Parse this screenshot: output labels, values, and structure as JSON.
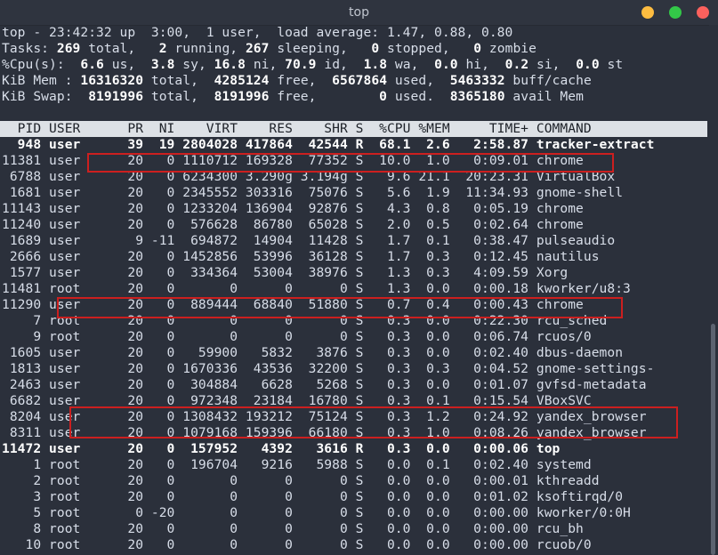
{
  "window": {
    "title": "top"
  },
  "summary": {
    "uptime_line": "top - 23:42:32 up  3:00,  1 user,  load average: 1.47, 0.88, 0.80",
    "tasks": [
      {
        "t": "Tasks: "
      },
      {
        "t": "269",
        "b": true
      },
      {
        "t": " total,   "
      },
      {
        "t": "2",
        "b": true
      },
      {
        "t": " running, "
      },
      {
        "t": "267",
        "b": true
      },
      {
        "t": " sleeping,   "
      },
      {
        "t": "0",
        "b": true
      },
      {
        "t": " stopped,   "
      },
      {
        "t": "0",
        "b": true
      },
      {
        "t": " zombie"
      }
    ],
    "cpu": [
      {
        "t": "%Cpu(s):  "
      },
      {
        "t": "6.6",
        "b": true
      },
      {
        "t": " us,  "
      },
      {
        "t": "3.8",
        "b": true
      },
      {
        "t": " sy, "
      },
      {
        "t": "16.8",
        "b": true
      },
      {
        "t": " ni, "
      },
      {
        "t": "70.9",
        "b": true
      },
      {
        "t": " id,  "
      },
      {
        "t": "1.8",
        "b": true
      },
      {
        "t": " wa,  "
      },
      {
        "t": "0.0",
        "b": true
      },
      {
        "t": " hi,  "
      },
      {
        "t": "0.2",
        "b": true
      },
      {
        "t": " si,  "
      },
      {
        "t": "0.0",
        "b": true
      },
      {
        "t": " st"
      }
    ],
    "mem": [
      {
        "t": "KiB Mem : "
      },
      {
        "t": "16316320",
        "b": true
      },
      {
        "t": " total,  "
      },
      {
        "t": "4285124",
        "b": true
      },
      {
        "t": " free,  "
      },
      {
        "t": "6567864",
        "b": true
      },
      {
        "t": " used,  "
      },
      {
        "t": "5463332",
        "b": true
      },
      {
        "t": " buff/cache"
      }
    ],
    "swap": [
      {
        "t": "KiB Swap:  "
      },
      {
        "t": "8191996",
        "b": true
      },
      {
        "t": " total,  "
      },
      {
        "t": "8191996",
        "b": true
      },
      {
        "t": " free,        "
      },
      {
        "t": "0",
        "b": true
      },
      {
        "t": " used.  "
      },
      {
        "t": "8365180",
        "b": true
      },
      {
        "t": " avail Mem"
      }
    ]
  },
  "table": {
    "header": "  PID USER      PR  NI    VIRT    RES    SHR S  %CPU %MEM     TIME+ COMMAND",
    "rows": [
      {
        "line": "  948 user      39  19 2804028 417864  42544 R  68.1  2.6   2:58.87 tracker-extract",
        "bold": true
      },
      {
        "line": "11381 user      20   0 1110712 169328  77352 S  10.0  1.0   0:09.01 chrome"
      },
      {
        "line": " 6788 user      20   0 6234300 3.290g 3.194g S   9.6 21.1  20:23.31 VirtualBox"
      },
      {
        "line": " 1681 user      20   0 2345552 303316  75076 S   5.6  1.9  11:34.93 gnome-shell"
      },
      {
        "line": "11143 user      20   0 1233204 136904  92876 S   4.3  0.8   0:05.19 chrome"
      },
      {
        "line": "11240 user      20   0  576628  86780  65028 S   2.0  0.5   0:02.64 chrome"
      },
      {
        "line": " 1689 user       9 -11  694872  14904  11428 S   1.7  0.1   0:38.47 pulseaudio"
      },
      {
        "line": " 2666 user      20   0 1452856  53996  36128 S   1.7  0.3   0:12.45 nautilus"
      },
      {
        "line": " 1577 user      20   0  334364  53004  38976 S   1.3  0.3   4:09.59 Xorg"
      },
      {
        "line": "11481 root      20   0       0      0      0 S   1.3  0.0   0:00.18 kworker/u8:3"
      },
      {
        "line": "11290 user      20   0  889444  68840  51880 S   0.7  0.4   0:00.43 chrome"
      },
      {
        "line": "    7 root      20   0       0      0      0 S   0.3  0.0   0:22.30 rcu_sched"
      },
      {
        "line": "    9 root      20   0       0      0      0 S   0.3  0.0   0:06.74 rcuos/0"
      },
      {
        "line": " 1605 user      20   0   59900   5832   3876 S   0.3  0.0   0:02.40 dbus-daemon"
      },
      {
        "line": " 1813 user      20   0 1670336  43536  32200 S   0.3  0.3   0:04.52 gnome-settings-"
      },
      {
        "line": " 2463 user      20   0  304884   6628   5268 S   0.3  0.0   0:01.07 gvfsd-metadata"
      },
      {
        "line": " 6682 user      20   0  972348  23184  16780 S   0.3  0.1   0:15.54 VBoxSVC"
      },
      {
        "line": " 8204 user      20   0 1308432 193212  75124 S   0.3  1.2   0:24.92 yandex_browser"
      },
      {
        "line": " 8311 user      20   0 1079168 159396  66180 S   0.3  1.0   0:08.26 yandex_browser"
      },
      {
        "line": "11472 user      20   0  157952   4392   3616 R   0.3  0.0   0:00.06 top",
        "bold": true
      },
      {
        "line": "    1 root      20   0  196704   9216   5988 S   0.0  0.1   0:02.40 systemd"
      },
      {
        "line": "    2 root      20   0       0      0      0 S   0.0  0.0   0:00.01 kthreadd"
      },
      {
        "line": "    3 root      20   0       0      0      0 S   0.0  0.0   0:01.02 ksoftirqd/0"
      },
      {
        "line": "    5 root       0 -20       0      0      0 S   0.0  0.0   0:00.00 kworker/0:0H"
      },
      {
        "line": "    8 root      20   0       0      0      0 S   0.0  0.0   0:00.00 rcu_bh"
      },
      {
        "line": "   10 root      20   0       0      0      0 S   0.0  0.0   0:00.00 rcuob/0"
      }
    ]
  },
  "annotations": {
    "highlight_color": "#cc1f1f"
  },
  "theme": {
    "terminal_bg": "#2b303b",
    "text": "#d8dee9",
    "header_bg": "#dde1e6",
    "btn_min": "#fdbc40",
    "btn_max": "#33c748",
    "btn_close": "#fc615d"
  }
}
